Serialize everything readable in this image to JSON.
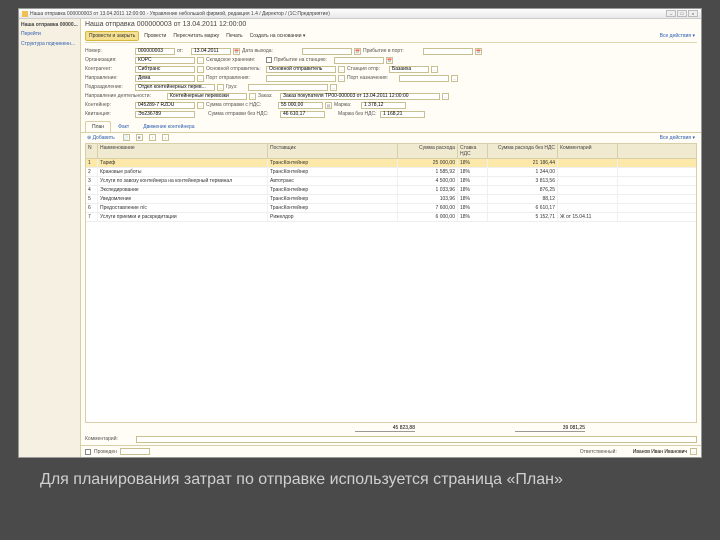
{
  "window": {
    "title": "Наша отправка 000000003 от 13.04.2011 12:00:00 - Управление небольшой фирмой, редакция 1.4 / Директор / (1С:Предприятие)"
  },
  "sidebar": {
    "current": "Наша отправка 00000...",
    "links": [
      "Перейти",
      "Структура подчиненн..."
    ]
  },
  "doc": {
    "title": "Наша отправка 000000003 от 13.04.2011 12:00:00",
    "toolbar": {
      "save": "Провести и закрыть",
      "items": [
        "Провести",
        "Пересчитать маржу",
        "Печать",
        "Создать на основании ▾"
      ],
      "all": "Все действия ▾"
    }
  },
  "form": {
    "number_lbl": "Номер:",
    "number": "000000003",
    "from": "от:",
    "date": "13.04.2011",
    "date_arr_lbl": "Дата выхода:",
    "port_arr_lbl": "Прибытие в порт:",
    "org_lbl": "Организация:",
    "org": "КОРС",
    "storage_lbl": "Складское хранение:",
    "storage_chk_lbl": "Прибытие на станцию:",
    "contr_lbl": "Контрагент:",
    "contr": "Сибтранс",
    "main_sender_lbl": "Основной отправитель:",
    "main_sender": "Основной отправитель",
    "station_lbl": "Станция отпр:",
    "station": "Базаиха",
    "direction_lbl": "Направление:",
    "direction": "Дема",
    "port_dep_lbl": "Порт отправления:",
    "port_dest_lbl": "Порт назначения:",
    "subdiv_lbl": "Подразделение:",
    "subdiv": "Отдел контейнерных перев...",
    "cargo_lbl": "Груз:",
    "activity_lbl": "Направление деятельности:",
    "activity": "Контейнерные перевозки",
    "order_lbl": "Заказ:",
    "order": "Заказ покупателя ТР00-000003 от 13.04.2011 12:00:00",
    "container_lbl": "Контейнер:",
    "container": "045289-7 RZDU",
    "sum_lbl": "Сумма отправки с НДС:",
    "sum": "55 000,00",
    "margin_lbl": "Маржа:",
    "margin": "1 378,12",
    "quota_lbl": "Квитанция:",
    "quota": "Эо236789",
    "sum2_lbl": "Сумма отправки без НДС:",
    "sum2": "46 610,17",
    "margin2_lbl": "Маржа без НДС:",
    "margin2": "1 168,21"
  },
  "tabs": [
    "План",
    "Факт",
    "Движение контейнера"
  ],
  "grid": {
    "add": "Добавить",
    "all": "Все действия ▾",
    "cols": [
      "N",
      "Наименование",
      "Поставщик",
      "Сумма расхода",
      "Ставка НДС",
      "Сумма расхода без НДС",
      "Комментарий"
    ],
    "rows": [
      {
        "n": "1",
        "name": "Тариф",
        "post": "ТрансКонтейнер",
        "sum": "25 000,00",
        "vat": "18%",
        "sumv": "21 186,44",
        "com": ""
      },
      {
        "n": "2",
        "name": "Крановые работы",
        "post": "ТрансКонтейнер",
        "sum": "1 585,92",
        "vat": "18%",
        "sumv": "1 344,00",
        "com": ""
      },
      {
        "n": "3",
        "name": "Услуги по завозу контейнера на контейнерный терминал",
        "post": "Автотранс",
        "sum": "4 500,00",
        "vat": "18%",
        "sumv": "3 813,56",
        "com": ""
      },
      {
        "n": "4",
        "name": "Экспедирование",
        "post": "ТрансКонтейнер",
        "sum": "1 033,96",
        "vat": "18%",
        "sumv": "876,25",
        "com": ""
      },
      {
        "n": "5",
        "name": "Уведомление",
        "post": "ТрансКонтейнер",
        "sum": "103,96",
        "vat": "18%",
        "sumv": "88,12",
        "com": ""
      },
      {
        "n": "6",
        "name": "Предоставление п/с",
        "post": "ТрансКонтейнер",
        "sum": "7 600,00",
        "vat": "18%",
        "sumv": "6 610,17",
        "com": ""
      },
      {
        "n": "7",
        "name": "Услуги приемки и раскредитации",
        "post": "Рижелдор",
        "sum": "6 000,00",
        "vat": "18%",
        "sumv": "5 152,71",
        "com": "Ж от 15.04.11"
      }
    ],
    "tot_sum": "45 823,88",
    "tot_sumv": "39 081,25"
  },
  "comment_lbl": "Комментарий:",
  "footer": {
    "rec_lbl": "Проведен",
    "resp_lbl": "Ответственный:",
    "resp": "Иванов Иван Иванович"
  },
  "caption": "Для планирования затрат по отправке используется страница «План»"
}
